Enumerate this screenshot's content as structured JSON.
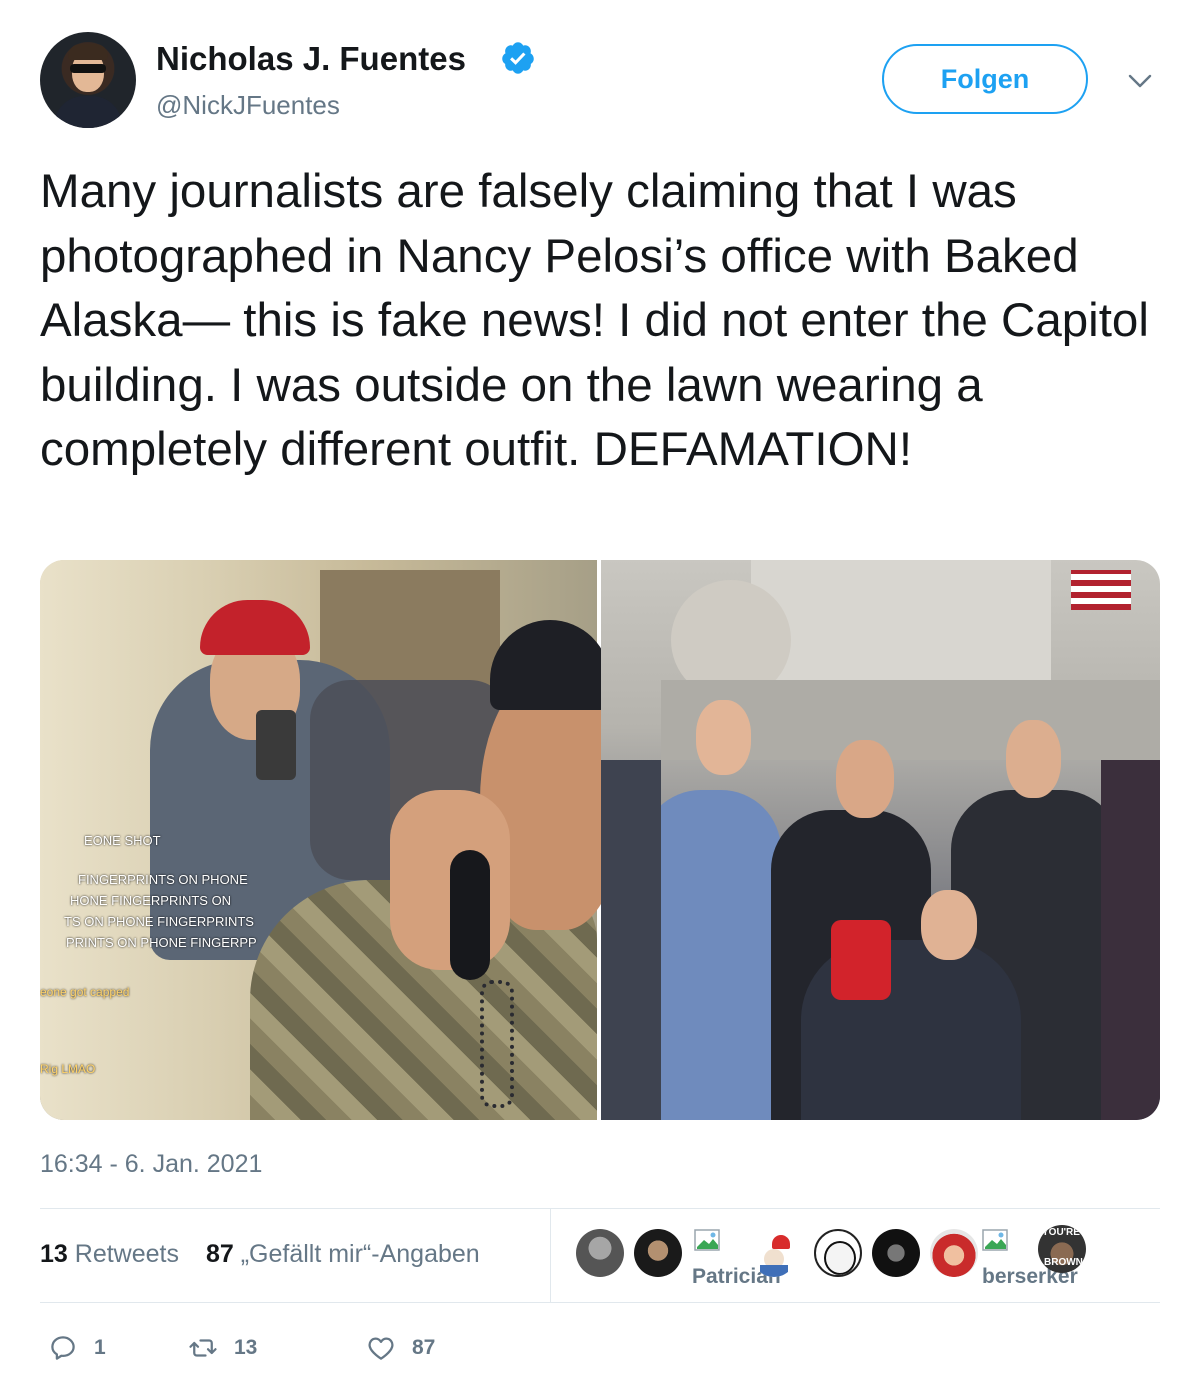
{
  "header": {
    "display_name": "Nicholas J. Fuentes",
    "handle": "@NickJFuentes",
    "follow_label": "Folgen",
    "verified": true,
    "accent_color": "#1da1f2"
  },
  "tweet": {
    "text": "Many journalists are falsely claiming that I was photographed in Nancy Pelosi’s office with Baked Alaska— this is fake news! I did not enter the Capitol building. I was outside on the lawn wearing a completely different outfit. DEFAMATION!",
    "timestamp": "16:34 - 6. Jan. 2021"
  },
  "media": {
    "left_overlay_lines": [
      "EONE SHOT",
      "FINGERPRINTS ON PHONE",
      "HONE FINGERPRINTS ON",
      "TS ON PHONE FINGERPRINTS",
      "PRINTS ON PHONE FINGERPP"
    ],
    "left_caption_1": "eone got capped",
    "left_caption_2": "Rig LMAO"
  },
  "stats": {
    "retweets_count": "13",
    "retweets_label": "Retweets",
    "likes_count": "87",
    "likes_label": "„Gefällt mir“-Angaben"
  },
  "likers": {
    "label_1": "Patrician",
    "label_2": "berserker",
    "badge_text_top": "YOU'RE",
    "badge_text_bottom": "BROWN"
  },
  "actions": {
    "reply_count": "1",
    "retweet_count": "13",
    "like_count": "87"
  }
}
